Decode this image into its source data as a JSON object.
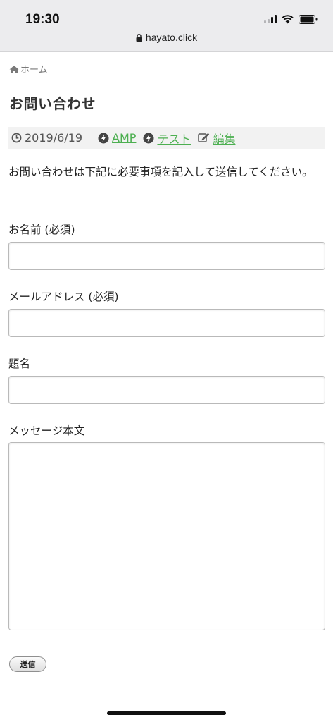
{
  "status_bar": {
    "time": "19:30"
  },
  "browser": {
    "url": "hayato.click"
  },
  "breadcrumb": {
    "home_label": "ホーム"
  },
  "page": {
    "title": "お問い合わせ"
  },
  "meta": {
    "date": "2019/6/19",
    "categories": [
      "AMP",
      "テスト"
    ],
    "edit_label": "編集",
    "link_color": "#4caf50"
  },
  "intro": "お問い合わせは下記に必要事項を記入して送信してください。",
  "form": {
    "name_label": "お名前 (必須)",
    "email_label": "メールアドレス (必須)",
    "subject_label": "題名",
    "message_label": "メッセージ本文",
    "name_value": "",
    "email_value": "",
    "subject_value": "",
    "message_value": "",
    "submit_label": "送信"
  },
  "icons": [
    "lock-icon",
    "home-icon",
    "clock-icon",
    "bolt-icon",
    "edit-icon",
    "wifi-icon",
    "battery-icon",
    "signal-icon"
  ]
}
